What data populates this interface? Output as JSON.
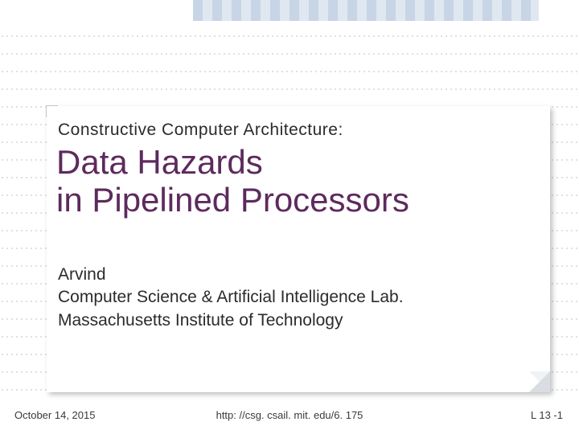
{
  "subtitle": "Constructive Computer Architecture:",
  "title_line1": "Data Hazards",
  "title_line2": "in Pipelined Processors",
  "author": "Arvind",
  "affiliation_line1": "Computer Science & Artificial Intelligence Lab.",
  "affiliation_line2": "Massachusetts Institute of Technology",
  "footer": {
    "date": "October 14, 2015",
    "url": "http: //csg. csail. mit. edu/6. 175",
    "page": "L 13 -1"
  },
  "colors": {
    "title": "#5d2a5d",
    "stripes_dark": "#c7d5e6",
    "stripes_light": "#dfe7f1"
  }
}
